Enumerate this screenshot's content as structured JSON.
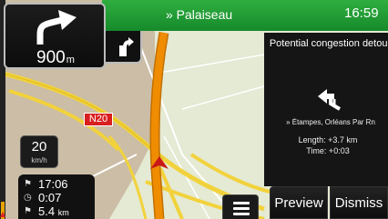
{
  "top_bar": {
    "street": "» Palaiseau",
    "clock": "16:59"
  },
  "turn": {
    "distance_value": "900",
    "distance_unit": "m",
    "icon": "turn-left-arrow-icon"
  },
  "next_turn": {
    "icon": "next-turn-icon"
  },
  "map": {
    "road_label": "N20",
    "position_marker": "car-position-icon"
  },
  "speed_limit": {
    "value": "20",
    "unit": "km/h"
  },
  "trip": {
    "arrival": "17:06",
    "remaining_time": "0:07",
    "distance_value": "5.4",
    "distance_unit": "km"
  },
  "route_progress": {
    "fraction": 0.08
  },
  "menu": {
    "icon": "hamburger-menu-icon"
  },
  "detour_panel": {
    "title": "Potential congestion detour:",
    "icon": "detour-arrow-icon",
    "route": "» Étampes, Orléans Par Rn",
    "length": "Length: +3.7 km",
    "time": "Time: +0:03"
  },
  "buttons": {
    "preview": "Preview",
    "dismiss": "Dismiss"
  },
  "colors": {
    "top_bar": "#1e9a34",
    "road_orange": "#e68a00",
    "road_yellow": "#f2d23c",
    "road_label": "#d92020",
    "map_land": "#e7ecd5",
    "map_urban": "#cdbfa9"
  }
}
